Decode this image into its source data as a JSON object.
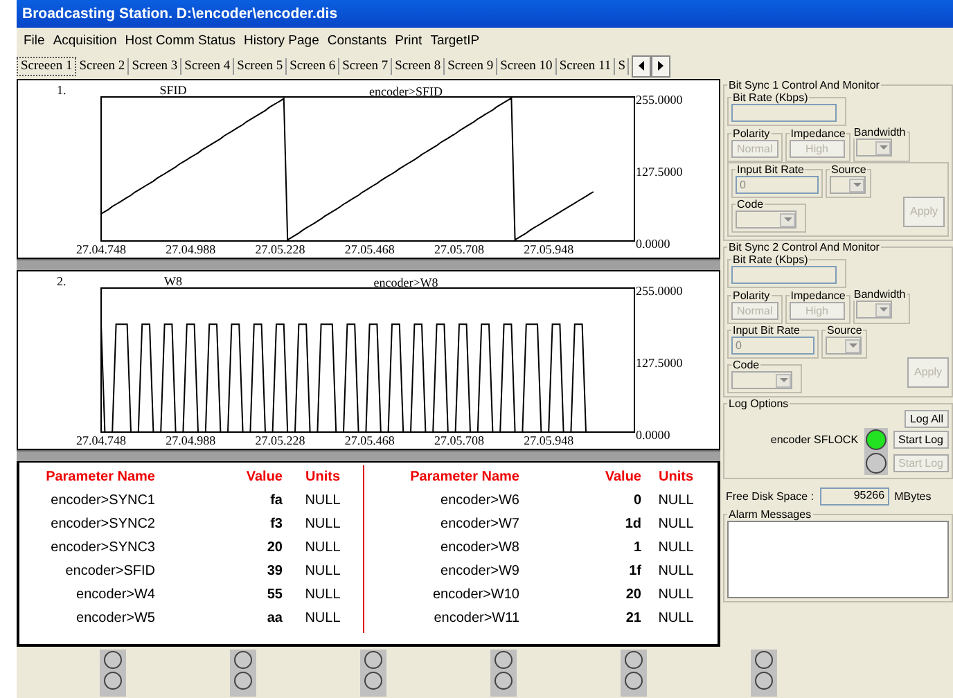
{
  "window": {
    "title": "Broadcasting Station.  D:\\encoder\\encoder.dis"
  },
  "menu": [
    "File",
    "Acquisition",
    "Host Comm Status",
    "History Page",
    "Constants",
    "Print",
    "TargetIP"
  ],
  "tabs": [
    {
      "label": "Screeen 1",
      "selected": true
    },
    {
      "label": "Screen 2",
      "selected": false
    },
    {
      "label": "Screen 3",
      "selected": false
    },
    {
      "label": "Screen 4",
      "selected": false
    },
    {
      "label": "Screen 5",
      "selected": false
    },
    {
      "label": "Screen 6",
      "selected": false
    },
    {
      "label": "Screen 7",
      "selected": false
    },
    {
      "label": "Screen 8",
      "selected": false
    },
    {
      "label": "Screen 9",
      "selected": false
    },
    {
      "label": "Screen 10",
      "selected": false
    },
    {
      "label": "Screen 11",
      "selected": false
    },
    {
      "label": "S",
      "selected": false
    }
  ],
  "charts": [
    {
      "number": "1.",
      "chart_data": {
        "type": "line",
        "title": "SFID",
        "categories": [
          "27.04.748",
          null,
          null,
          null,
          null,
          null,
          null,
          null,
          null,
          null,
          null,
          null,
          null,
          null,
          null,
          null,
          null,
          null,
          null,
          null,
          null,
          null,
          null,
          null,
          "27.04.988",
          null,
          null,
          null,
          null,
          null,
          null,
          null,
          null,
          null,
          null,
          null,
          null,
          null,
          null,
          null,
          null,
          null,
          null,
          null,
          null,
          null,
          null,
          null,
          "27.05.228",
          null,
          null,
          null,
          null,
          null,
          null,
          null,
          null,
          null,
          null,
          null,
          null,
          null,
          null,
          null,
          null,
          null,
          null,
          null,
          null,
          null,
          null,
          null,
          "27.05.468",
          null,
          null,
          null,
          null,
          null,
          null,
          null,
          null,
          null,
          null,
          null,
          null,
          null,
          null,
          null,
          null,
          null,
          null,
          null,
          null,
          null,
          null,
          null,
          "27.05.708",
          null,
          null,
          null,
          null,
          null,
          null,
          null,
          null,
          null,
          null,
          null,
          null,
          null,
          null,
          null,
          null,
          null,
          null,
          null,
          null,
          null,
          null,
          null,
          "27.05.948",
          null,
          null,
          null,
          null,
          null,
          null,
          null,
          null,
          null,
          null,
          null,
          null,
          null,
          null,
          null,
          null,
          null,
          null,
          null,
          null,
          null,
          null,
          null
        ],
        "series": [
          {
            "name": "encoder>SFID",
            "color": "#000000",
            "values": [
              48,
              52,
              56,
              61,
              65,
              69,
              73,
              77,
              81,
              86,
              90,
              94,
              98,
              102,
              106,
              111,
              115,
              119,
              123,
              127,
              131,
              136,
              140,
              144,
              148,
              152,
              156,
              161,
              165,
              169,
              173,
              177,
              181,
              186,
              190,
              194,
              198,
              202,
              206,
              211,
              215,
              219,
              223,
              227,
              231,
              236,
              240,
              244,
              248,
              252,
              2,
              6,
              10,
              14,
              19,
              23,
              27,
              31,
              35,
              39,
              44,
              48,
              52,
              56,
              60,
              65,
              69,
              73,
              77,
              81,
              86,
              90,
              94,
              98,
              102,
              107,
              111,
              115,
              119,
              123,
              128,
              132,
              136,
              140,
              144,
              148,
              153,
              157,
              161,
              165,
              169,
              174,
              178,
              182,
              186,
              190,
              195,
              199,
              203,
              207,
              211,
              216,
              220,
              224,
              228,
              232,
              237,
              241,
              245,
              249,
              253,
              2,
              6,
              10,
              14,
              19,
              23,
              27,
              31,
              35,
              39,
              43,
              47,
              51,
              55,
              59,
              63,
              67,
              71,
              75,
              79,
              83,
              87,
              null,
              null,
              null,
              null,
              null,
              null,
              null,
              null,
              null,
              null,
              null
            ]
          }
        ],
        "ylim": [
          0,
          255
        ],
        "yticks": [
          {
            "value": 0,
            "label": "0.0000"
          },
          {
            "value": 127.5,
            "label": "127.5000"
          },
          {
            "value": 255,
            "label": "255.0000"
          }
        ]
      }
    },
    {
      "number": "2.",
      "chart_data": {
        "type": "line",
        "title": "W8",
        "categories": [
          "27.04.748",
          null,
          null,
          null,
          null,
          null,
          null,
          null,
          null,
          null,
          null,
          null,
          null,
          null,
          null,
          null,
          null,
          null,
          null,
          null,
          null,
          null,
          null,
          null,
          "27.04.988",
          null,
          null,
          null,
          null,
          null,
          null,
          null,
          null,
          null,
          null,
          null,
          null,
          null,
          null,
          null,
          null,
          null,
          null,
          null,
          null,
          null,
          null,
          null,
          "27.05.228",
          null,
          null,
          null,
          null,
          null,
          null,
          null,
          null,
          null,
          null,
          null,
          null,
          null,
          null,
          null,
          null,
          null,
          null,
          null,
          null,
          null,
          null,
          null,
          "27.05.468",
          null,
          null,
          null,
          null,
          null,
          null,
          null,
          null,
          null,
          null,
          null,
          null,
          null,
          null,
          null,
          null,
          null,
          null,
          null,
          null,
          null,
          null,
          null,
          "27.05.708",
          null,
          null,
          null,
          null,
          null,
          null,
          null,
          null,
          null,
          null,
          null,
          null,
          null,
          null,
          null,
          null,
          null,
          null,
          null,
          null,
          null,
          null,
          null,
          "27.05.948",
          null,
          null,
          null,
          null,
          null,
          null,
          null,
          null,
          null,
          null,
          null,
          null,
          null,
          null,
          null,
          null,
          null,
          null,
          null,
          null,
          null,
          null,
          null
        ],
        "series": [
          {
            "name": "encoder>W8",
            "color": "#000000",
            "values": [
              191,
              0,
              0,
              0,
              191,
              191,
              191,
              191,
              0,
              0,
              0,
              191,
              191,
              191,
              0,
              0,
              0,
              191,
              191,
              191,
              0,
              0,
              0,
              191,
              191,
              191,
              0,
              0,
              0,
              191,
              191,
              191,
              0,
              0,
              0,
              191,
              191,
              191,
              0,
              0,
              0,
              191,
              191,
              191,
              0,
              0,
              0,
              191,
              191,
              191,
              0,
              0,
              0,
              191,
              191,
              191,
              0,
              0,
              0,
              191,
              191,
              191,
              191,
              0,
              0,
              0,
              191,
              191,
              191,
              0,
              0,
              0,
              191,
              191,
              191,
              0,
              0,
              0,
              191,
              191,
              191,
              0,
              0,
              0,
              191,
              191,
              191,
              0,
              0,
              0,
              191,
              191,
              191,
              0,
              0,
              0,
              191,
              191,
              191,
              0,
              0,
              0,
              191,
              191,
              191,
              0,
              0,
              0,
              191,
              191,
              191,
              0,
              0,
              0,
              191,
              191,
              191,
              191,
              0,
              0,
              0,
              191,
              191,
              191,
              0,
              0,
              0,
              191,
              191,
              191,
              0,
              null,
              null,
              null,
              null,
              null,
              null,
              null,
              null,
              null,
              null,
              null,
              null,
              null
            ]
          }
        ],
        "ylim": [
          0,
          255
        ],
        "yticks": [
          {
            "value": 0,
            "label": "0.0000"
          },
          {
            "value": 127.5,
            "label": "127.5000"
          },
          {
            "value": 255,
            "label": "255.0000"
          }
        ]
      }
    }
  ],
  "parameter_tables": [
    {
      "columns": [
        "Parameter Name",
        "Value",
        "Units"
      ],
      "rows": [
        {
          "name": "encoder>SYNC1",
          "value": "fa",
          "units": "NULL"
        },
        {
          "name": "encoder>SYNC2",
          "value": "f3",
          "units": "NULL"
        },
        {
          "name": "encoder>SYNC3",
          "value": "20",
          "units": "NULL"
        },
        {
          "name": "encoder>SFID",
          "value": "39",
          "units": "NULL"
        },
        {
          "name": "encoder>W4",
          "value": "55",
          "units": "NULL"
        },
        {
          "name": "encoder>W5",
          "value": "aa",
          "units": "NULL"
        }
      ]
    },
    {
      "columns": [
        "Parameter Name",
        "Value",
        "Units"
      ],
      "rows": [
        {
          "name": "encoder>W6",
          "value": "0",
          "units": "NULL"
        },
        {
          "name": "encoder>W7",
          "value": "1d",
          "units": "NULL"
        },
        {
          "name": "encoder>W8",
          "value": "1",
          "units": "NULL"
        },
        {
          "name": "encoder>W9",
          "value": "1f",
          "units": "NULL"
        },
        {
          "name": "encoder>W10",
          "value": "20",
          "units": "NULL"
        },
        {
          "name": "encoder>W11",
          "value": "21",
          "units": "NULL"
        }
      ]
    }
  ],
  "bit_syncs": [
    {
      "title": "Bit Sync 1 Control And Monitor",
      "bit_rate": {
        "label": "Bit Rate (Kbps)"
      },
      "polarity": {
        "label": "Polarity",
        "button": "Normal"
      },
      "impedance": {
        "label": "Impedance",
        "button": "High"
      },
      "bandwidth": {
        "label": "Bandwidth"
      },
      "input_bit_rate": {
        "label": "Input Bit Rate",
        "placeholder": "0"
      },
      "source": {
        "label": "Source"
      },
      "code": {
        "label": "Code"
      },
      "apply": "Apply",
      "inner_frame": true
    },
    {
      "title": "Bit Sync 2 Control And Monitor",
      "bit_rate": {
        "label": "Bit Rate (Kbps)"
      },
      "polarity": {
        "label": "Polarity",
        "button": "Normal"
      },
      "impedance": {
        "label": "Impedance",
        "button": "High"
      },
      "bandwidth": {
        "label": "Bandwidth"
      },
      "input_bit_rate": {
        "label": "Input Bit Rate",
        "placeholder": "0"
      },
      "source": {
        "label": "Source"
      },
      "code": {
        "label": "Code"
      },
      "apply": "Apply",
      "inner_frame": false
    }
  ],
  "log_options": {
    "title": "Log Options",
    "log_all": "Log All",
    "entries": [
      {
        "label": "encoder  SFLOCK",
        "lit": true,
        "button": "Start Log",
        "disabled": false
      },
      {
        "lit": false,
        "button": "Start Log",
        "disabled": true
      }
    ]
  },
  "free_disk_space": {
    "label": "Free Disk Space :",
    "value": "95266",
    "unit": "MBytes"
  },
  "alarm_messages": {
    "title": "Alarm Messages"
  },
  "indicators": [
    [
      {
        "lit": false
      },
      {
        "lit": false
      }
    ],
    [
      {
        "lit": false
      },
      {
        "lit": false
      }
    ],
    [
      {
        "lit": false
      },
      {
        "lit": false
      }
    ],
    [
      {
        "lit": false
      },
      {
        "lit": false
      }
    ],
    [
      {
        "lit": false
      },
      {
        "lit": false
      }
    ],
    [
      {
        "lit": false
      },
      {
        "lit": false
      }
    ]
  ]
}
